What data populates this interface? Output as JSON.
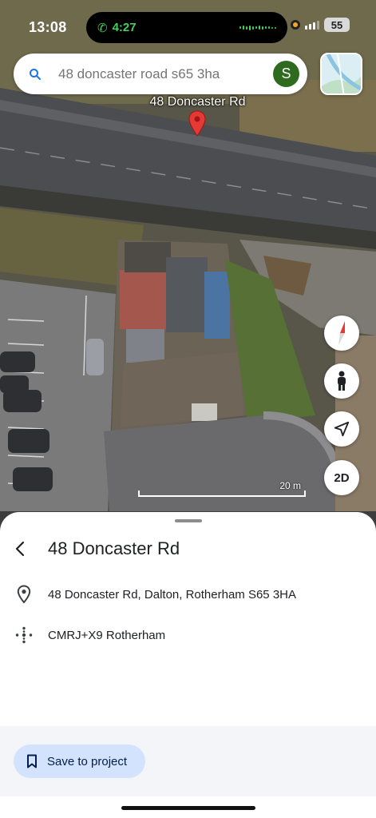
{
  "status_bar": {
    "time": "13:08",
    "call_time": "4:27",
    "battery": "55"
  },
  "search": {
    "query": "48 doncaster road s65 3ha",
    "avatar_letter": "S"
  },
  "map": {
    "pin_label": "48 Doncaster Rd",
    "view_mode": "2D",
    "scale_label": "20 m",
    "pin_color": "#e53935"
  },
  "place": {
    "title": "48 Doncaster Rd",
    "address": "48 Doncaster Rd, Dalton, Rotherham S65 3HA",
    "plus_code": "CMRJ+X9 Rotherham"
  },
  "actions": {
    "save_label": "Save to project"
  },
  "icons": {
    "search": "search-icon",
    "back": "back-arrow-icon",
    "location": "location-pin-icon",
    "plus_code": "plus-code-icon",
    "bookmark": "bookmark-icon",
    "compass": "compass-icon",
    "street_view": "pegman-icon",
    "navigate": "navigation-arrow-icon"
  },
  "colors": {
    "accent": "#1a73e8",
    "save_button_bg": "#d3e3fd",
    "avatar_bg": "#2e6b1f"
  }
}
